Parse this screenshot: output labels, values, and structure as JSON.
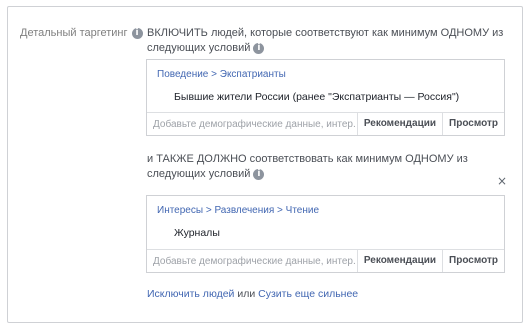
{
  "section_label": "Детальный таргетинг",
  "include_block": {
    "heading": "ВКЛЮЧИТЬ людей, которые соответствуют как минимум ОДНОМУ из следующих условий",
    "path": "Поведение > Экспатрианты",
    "item": "Бывшие жители России (ранее \"Экспатрианты — Россия\")",
    "search_placeholder": "Добавьте демографические данные, интер...",
    "recommend_label": "Рекомендации",
    "browse_label": "Просмотр"
  },
  "narrow_block": {
    "heading": "и ТАКЖЕ ДОЛЖНО соответствовать как минимум ОДНОМУ из следующих условий",
    "close": "×",
    "path": "Интересы > Развлечения > Чтение",
    "item": "Журналы",
    "search_placeholder": "Добавьте демографические данные, интер...",
    "recommend_label": "Рекомендации",
    "browse_label": "Просмотр"
  },
  "footer": {
    "exclude_link": "Исключить людей",
    "or_text": " или ",
    "narrow_link": "Сузить еще сильнее"
  }
}
